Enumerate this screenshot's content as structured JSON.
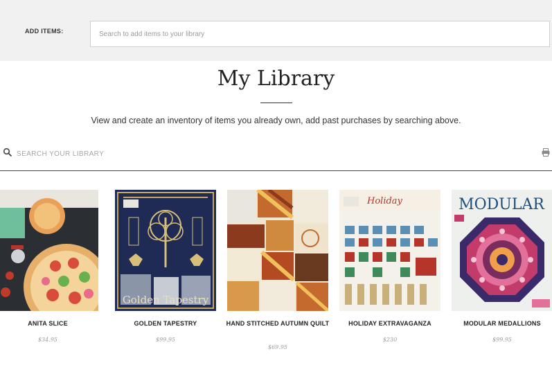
{
  "add_items": {
    "label": "ADD ITEMS:",
    "placeholder": "Search to add items to your library"
  },
  "header": {
    "title": "My Library",
    "subtitle": "View and create an inventory of items you already own, add past purchases by searching above."
  },
  "library_search": {
    "placeholder": "SEARCH YOUR LIBRARY",
    "search_icon": "search-icon",
    "print_icon": "printer-icon"
  },
  "products": [
    {
      "name": "ANITA SLICE",
      "price": "$34.95",
      "cover_text": ""
    },
    {
      "name": "GOLDEN TAPESTRY",
      "price": "$99.95",
      "cover_text": "Golden Tapestry"
    },
    {
      "name": "HAND STITCHED AUTUMN QUILT",
      "price": "$69.95",
      "cover_text": ""
    },
    {
      "name": "HOLIDAY EXTRAVAGANZA",
      "price": "$230",
      "cover_text": "Holiday"
    },
    {
      "name": "MODULAR MEDALLIONS",
      "price": "$99.95",
      "cover_text": "MODULAR"
    }
  ],
  "colors": {
    "add_bar_bg": "#f1f1f1",
    "accent_dark": "#222222",
    "price_gray": "#9b9b9b"
  }
}
